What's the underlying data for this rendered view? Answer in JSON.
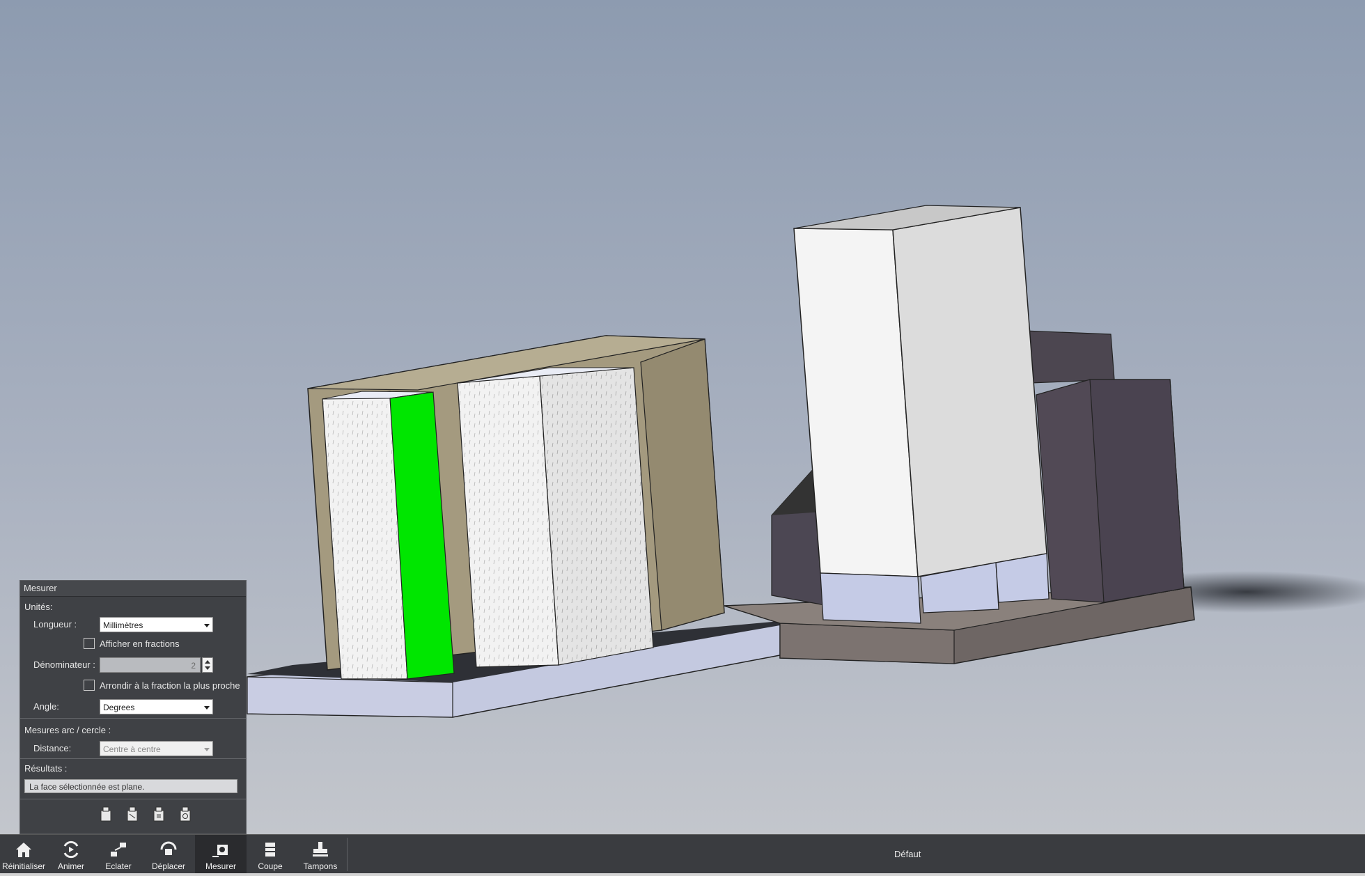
{
  "panel": {
    "title": "Mesurer",
    "units_label": "Unités:",
    "length_label": "Longueur :",
    "length_value": "Millimètres",
    "show_fractions_label": "Afficher en fractions",
    "denominator_label": "Dénominateur :",
    "denominator_value": "2",
    "round_label": "Arrondir à la fraction la plus proche",
    "angle_label": "Angle:",
    "angle_value": "Degrees",
    "arc_section_label": "Mesures arc / cercle :",
    "distance_label": "Distance:",
    "distance_value": "Centre à centre",
    "results_label": "Résultats :",
    "results_value": "La face sélectionnée est plane.",
    "tool_icons": [
      "measure-point-icon",
      "measure-edge-icon",
      "measure-face-icon",
      "measure-history-icon"
    ]
  },
  "toolbar": {
    "buttons": [
      {
        "label": "Réinitialiser",
        "icon": "home-icon"
      },
      {
        "label": "Animer",
        "icon": "animate-icon"
      },
      {
        "label": "Eclater",
        "icon": "explode-icon"
      },
      {
        "label": "Déplacer",
        "icon": "move-icon"
      },
      {
        "label": "Mesurer",
        "icon": "measure-icon",
        "active": true
      },
      {
        "label": "Coupe",
        "icon": "section-icon"
      },
      {
        "label": "Tampons",
        "icon": "stamp-icon"
      }
    ],
    "configuration": "Défaut"
  },
  "colors": {
    "selected_face": "#00e600",
    "panel_bg": "#3f4145",
    "toolbar_bg": "#3a3c40"
  }
}
